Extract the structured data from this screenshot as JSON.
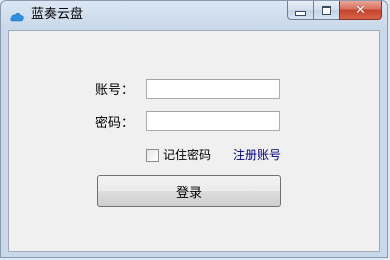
{
  "window": {
    "title": "蓝奏云盘",
    "icon": "cloud-icon",
    "controls": {
      "minimize_icon": "minimize-icon",
      "maximize_icon": "maximize-icon",
      "close_glyph": "✕"
    }
  },
  "form": {
    "account_label": "账号：",
    "account_value": "",
    "password_label": "密码：",
    "password_value": "",
    "remember_label": "记住密码",
    "remember_checked": false,
    "register_link": "注册账号",
    "login_button": "登录"
  },
  "colors": {
    "link": "#000080",
    "close_button": "#c3432b",
    "cloud_icon": "#2f8ee0"
  }
}
